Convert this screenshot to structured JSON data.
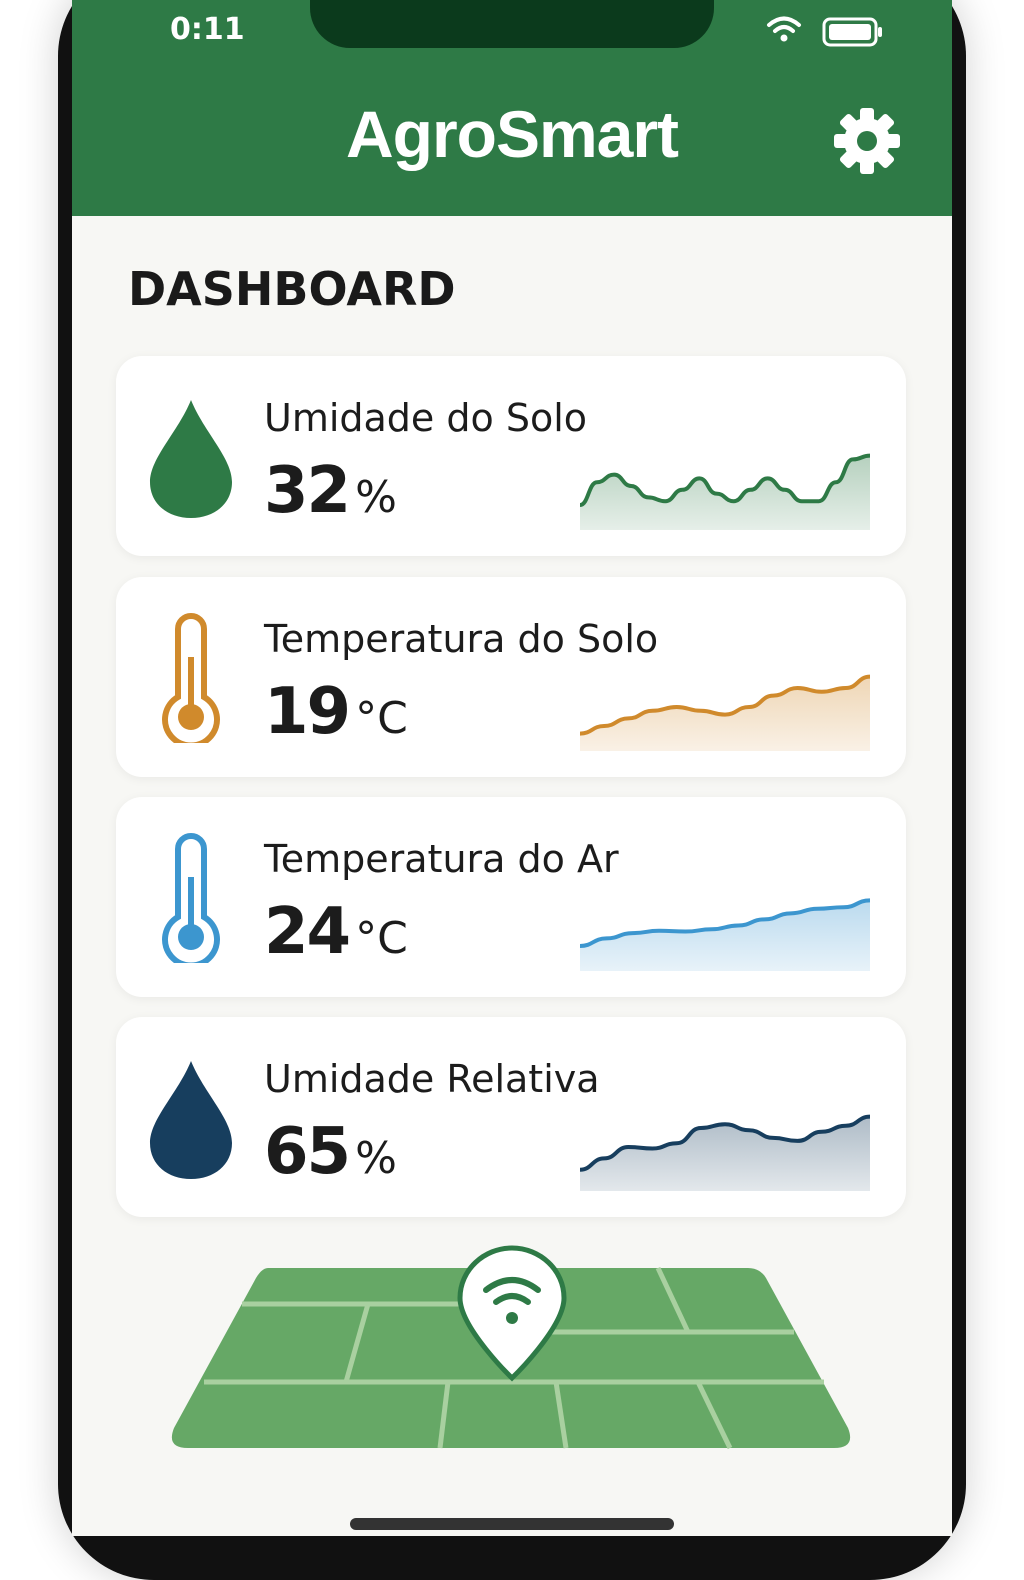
{
  "status_bar": {
    "time": "0:11",
    "icons": [
      "wifi-icon",
      "battery-icon"
    ]
  },
  "header": {
    "app_title": "AgroSmart",
    "settings_icon": "gear-icon",
    "color": "#2e7a46"
  },
  "dashboard": {
    "title": "DASHBOARD",
    "cards": [
      {
        "label": "Umidade do Solo",
        "value": "32",
        "unit": "%",
        "icon": "water-drop-icon",
        "color": "#2e7a46",
        "trend": [
          0.25,
          0.55,
          0.65,
          0.5,
          0.35,
          0.3,
          0.45,
          0.6,
          0.4,
          0.3,
          0.45,
          0.6,
          0.45,
          0.3,
          0.3,
          0.55,
          0.85,
          0.9
        ]
      },
      {
        "label": "Temperatura do Solo",
        "value": "19",
        "unit": "°C",
        "icon": "thermometer-icon",
        "color": "#d08a2c",
        "trend": [
          0.15,
          0.25,
          0.35,
          0.45,
          0.5,
          0.45,
          0.4,
          0.5,
          0.65,
          0.75,
          0.7,
          0.75,
          0.9
        ]
      },
      {
        "label": "Temperatura do Ar",
        "value": "24",
        "unit": "°C",
        "icon": "thermometer-icon",
        "color": "#3c96cf",
        "trend": [
          0.25,
          0.35,
          0.42,
          0.45,
          0.44,
          0.47,
          0.52,
          0.6,
          0.68,
          0.74,
          0.76,
          0.85
        ]
      },
      {
        "label": "Umidade Relativa",
        "value": "65",
        "unit": "%",
        "icon": "water-drop-icon",
        "color": "#173e5e",
        "trend": [
          0.2,
          0.35,
          0.5,
          0.48,
          0.55,
          0.75,
          0.8,
          0.72,
          0.62,
          0.58,
          0.7,
          0.78,
          0.9
        ]
      }
    ]
  },
  "field_map": {
    "icon": "sensor-location-pin-icon",
    "field_color": "#66a866"
  }
}
